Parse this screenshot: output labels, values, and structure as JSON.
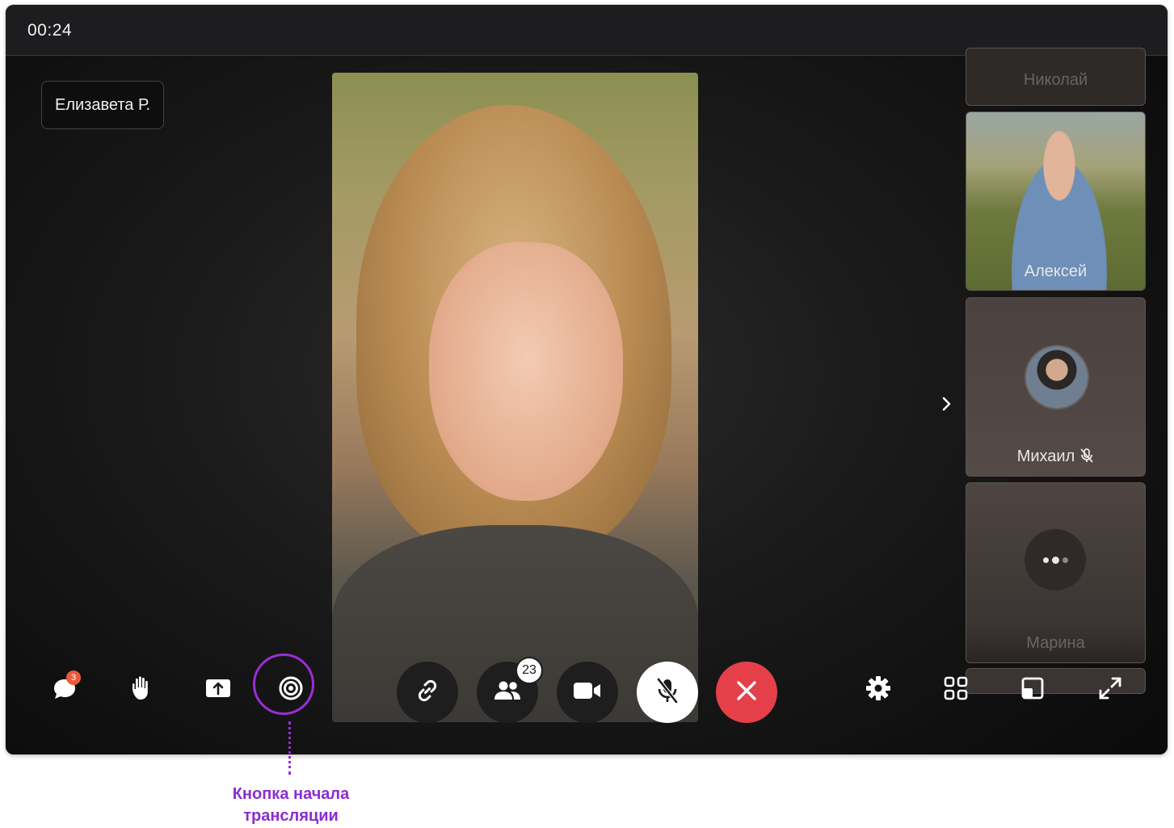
{
  "window": {
    "timer": "00:24"
  },
  "speaker": {
    "name": "Елизавета Р."
  },
  "participants": [
    {
      "name": "Николай"
    },
    {
      "name": "Алексей"
    },
    {
      "name": "Михаил",
      "muted": true
    },
    {
      "name": "Марина"
    }
  ],
  "toolbar": {
    "left": [
      {
        "icon": "chat-icon",
        "badge": "3"
      },
      {
        "icon": "raise-hand-icon"
      },
      {
        "icon": "share-screen-icon"
      },
      {
        "icon": "broadcast-icon"
      }
    ],
    "center": [
      {
        "icon": "link-icon"
      },
      {
        "icon": "participants-icon",
        "badge": "23"
      },
      {
        "icon": "camera-icon"
      },
      {
        "icon": "mic-off-icon"
      },
      {
        "icon": "end-call-icon"
      }
    ],
    "right": [
      {
        "icon": "gear-icon"
      },
      {
        "icon": "grid-layout-icon"
      },
      {
        "icon": "picture-in-picture-icon"
      },
      {
        "icon": "fullscreen-icon"
      }
    ]
  },
  "annotation": {
    "line1": "Кнопка начала",
    "line2": "трансляции"
  },
  "colors": {
    "accent": "#9b2dd6",
    "end_call": "#e5404a",
    "badge": "#ec5a3b"
  }
}
